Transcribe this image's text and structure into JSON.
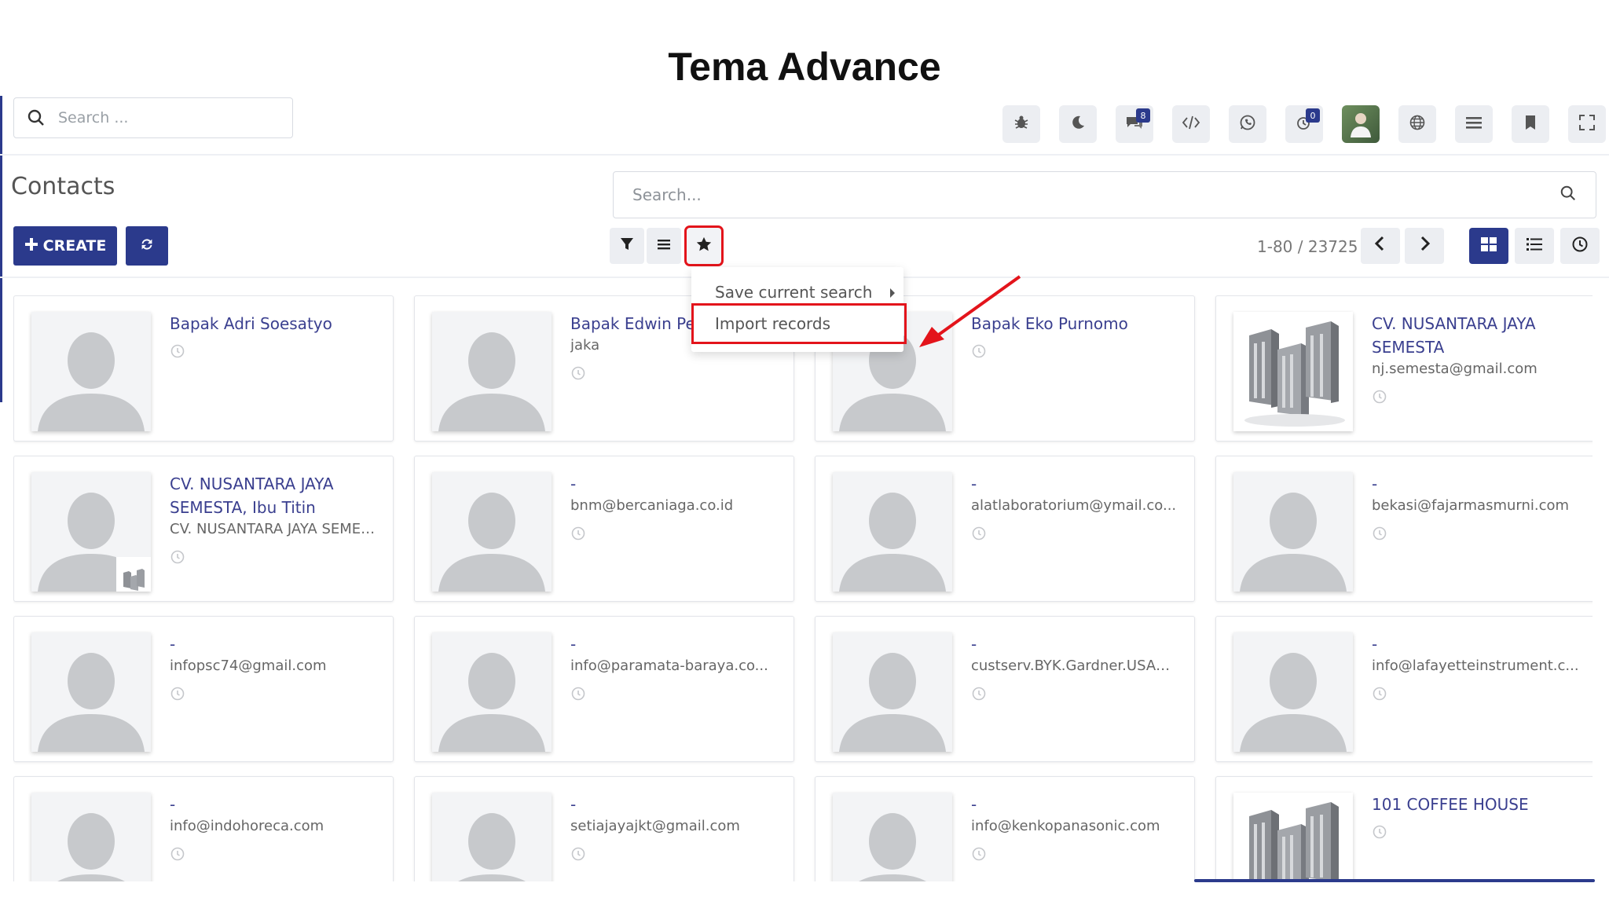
{
  "heading": "Tema Advance",
  "topbar": {
    "search_placeholder": "Search ...",
    "icons": [
      {
        "name": "bug-icon",
        "badge": ""
      },
      {
        "name": "moon-icon",
        "badge": ""
      },
      {
        "name": "chat-icon",
        "badge": "8"
      },
      {
        "name": "code-icon",
        "badge": ""
      },
      {
        "name": "whatsapp-icon",
        "badge": ""
      },
      {
        "name": "activity-icon",
        "badge": "0"
      },
      {
        "name": "user-avatar",
        "badge": ""
      },
      {
        "name": "globe-icon",
        "badge": ""
      },
      {
        "name": "menu-icon",
        "badge": ""
      },
      {
        "name": "bookmark-icon",
        "badge": ""
      },
      {
        "name": "fullscreen-icon",
        "badge": ""
      }
    ]
  },
  "control": {
    "title": "Contacts",
    "search_placeholder": "Search...",
    "create_label": "CREATE",
    "pager": "1-80 / 23725"
  },
  "dropdown": {
    "save_search": "Save current search",
    "import_records": "Import records"
  },
  "cards": [
    {
      "name": "Bapak Adri Soesatyo",
      "lines": [],
      "img": "person"
    },
    {
      "name": "Bapak Edwin Pe",
      "lines": [
        "jaka"
      ],
      "img": "person"
    },
    {
      "name": "Bapak Eko Purnomo",
      "lines": [],
      "img": "person"
    },
    {
      "name": "CV. NUSANTARA JAYA SEMESTA",
      "lines": [
        "nj.semesta@gmail.com"
      ],
      "img": "building"
    },
    {
      "name": "CV. NUSANTARA JAYA SEMESTA, Ibu Titin",
      "lines": [
        "CV. NUSANTARA JAYA SEMESTA"
      ],
      "img": "person-company"
    },
    {
      "name": "-",
      "lines": [
        "bnm@bercaniaga.co.id"
      ],
      "img": "person"
    },
    {
      "name": "-",
      "lines": [
        "alatlaboratorium@ymail.co..."
      ],
      "img": "person"
    },
    {
      "name": "-",
      "lines": [
        "bekasi@fajarmasmurni.com"
      ],
      "img": "person"
    },
    {
      "name": "-",
      "lines": [
        "infopsc74@gmail.com"
      ],
      "img": "person"
    },
    {
      "name": "-",
      "lines": [
        "info@paramata-baraya.co..."
      ],
      "img": "person"
    },
    {
      "name": "-",
      "lines": [
        "custserv.BYK.Gardner.USA@..."
      ],
      "img": "person"
    },
    {
      "name": "-",
      "lines": [
        "info@lafayetteinstrument.c..."
      ],
      "img": "person"
    },
    {
      "name": "-",
      "lines": [
        "info@indohoreca.com"
      ],
      "img": "person"
    },
    {
      "name": "-",
      "lines": [
        "setiajayajkt@gmail.com"
      ],
      "img": "person"
    },
    {
      "name": "-",
      "lines": [
        "info@kenkopanasonic.com"
      ],
      "img": "person"
    },
    {
      "name": "101 COFFEE HOUSE",
      "lines": [],
      "img": "building"
    }
  ]
}
